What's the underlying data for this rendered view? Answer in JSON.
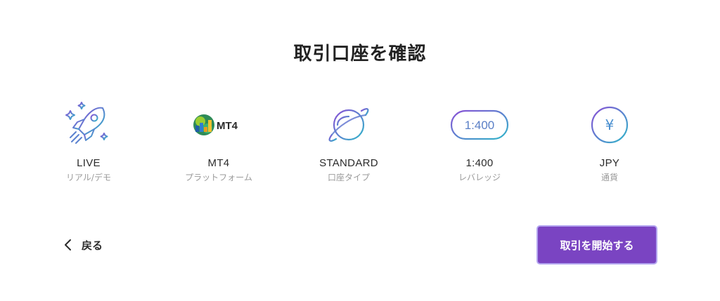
{
  "page": {
    "title": "取引口座を確認"
  },
  "summary": [
    {
      "value": "LIVE",
      "label": "リアル/デモ",
      "icon": "rocket-icon"
    },
    {
      "value": "MT4",
      "label": "プラットフォーム",
      "icon": "mt4-logo-icon",
      "logo_text": "MT4"
    },
    {
      "value": "STANDARD",
      "label": "口座タイプ",
      "icon": "planet-icon"
    },
    {
      "value": "1:400",
      "label": "レバレッジ",
      "icon": "leverage-badge-icon",
      "badge_text": "1:400"
    },
    {
      "value": "JPY",
      "label": "通貨",
      "icon": "yen-icon",
      "symbol": "¥"
    }
  ],
  "actions": {
    "back_label": "戻る",
    "start_label": "取引を開始する"
  },
  "colors": {
    "primary": "#7a44c2",
    "gradient_start": "#8a4fd6",
    "gradient_end": "#2fb6c9"
  }
}
